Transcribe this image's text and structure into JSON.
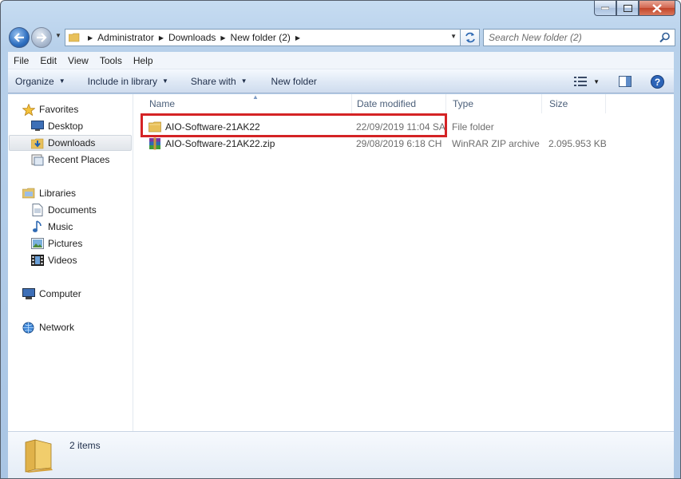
{
  "address": {
    "crumbs": [
      "Administrator",
      "Downloads",
      "New folder (2)"
    ]
  },
  "search": {
    "placeholder": "Search New folder (2)"
  },
  "menu": [
    "File",
    "Edit",
    "View",
    "Tools",
    "Help"
  ],
  "commands": {
    "organize": "Organize",
    "include_in_library": "Include in library",
    "share_with": "Share with",
    "new_folder": "New folder"
  },
  "nav": {
    "favorites": "Favorites",
    "desktop": "Desktop",
    "downloads": "Downloads",
    "recent_places": "Recent Places",
    "libraries": "Libraries",
    "documents": "Documents",
    "music": "Music",
    "pictures": "Pictures",
    "videos": "Videos",
    "computer": "Computer",
    "network": "Network"
  },
  "columns": {
    "name": "Name",
    "date_modified": "Date modified",
    "type": "Type",
    "size": "Size"
  },
  "files": [
    {
      "name": "AIO-Software-21AK22",
      "date": "22/09/2019 11:04 SA",
      "type": "File folder",
      "size": "",
      "icon": "folder-icon"
    },
    {
      "name": "AIO-Software-21AK22.zip",
      "date": "29/08/2019 6:18 CH",
      "type": "WinRAR ZIP archive",
      "size": "2.095.953 KB",
      "icon": "winrar-archive-icon"
    }
  ],
  "details": {
    "count": "2 items"
  },
  "colors": {
    "highlight": "#d42325",
    "selection": "#e1e5ea"
  }
}
